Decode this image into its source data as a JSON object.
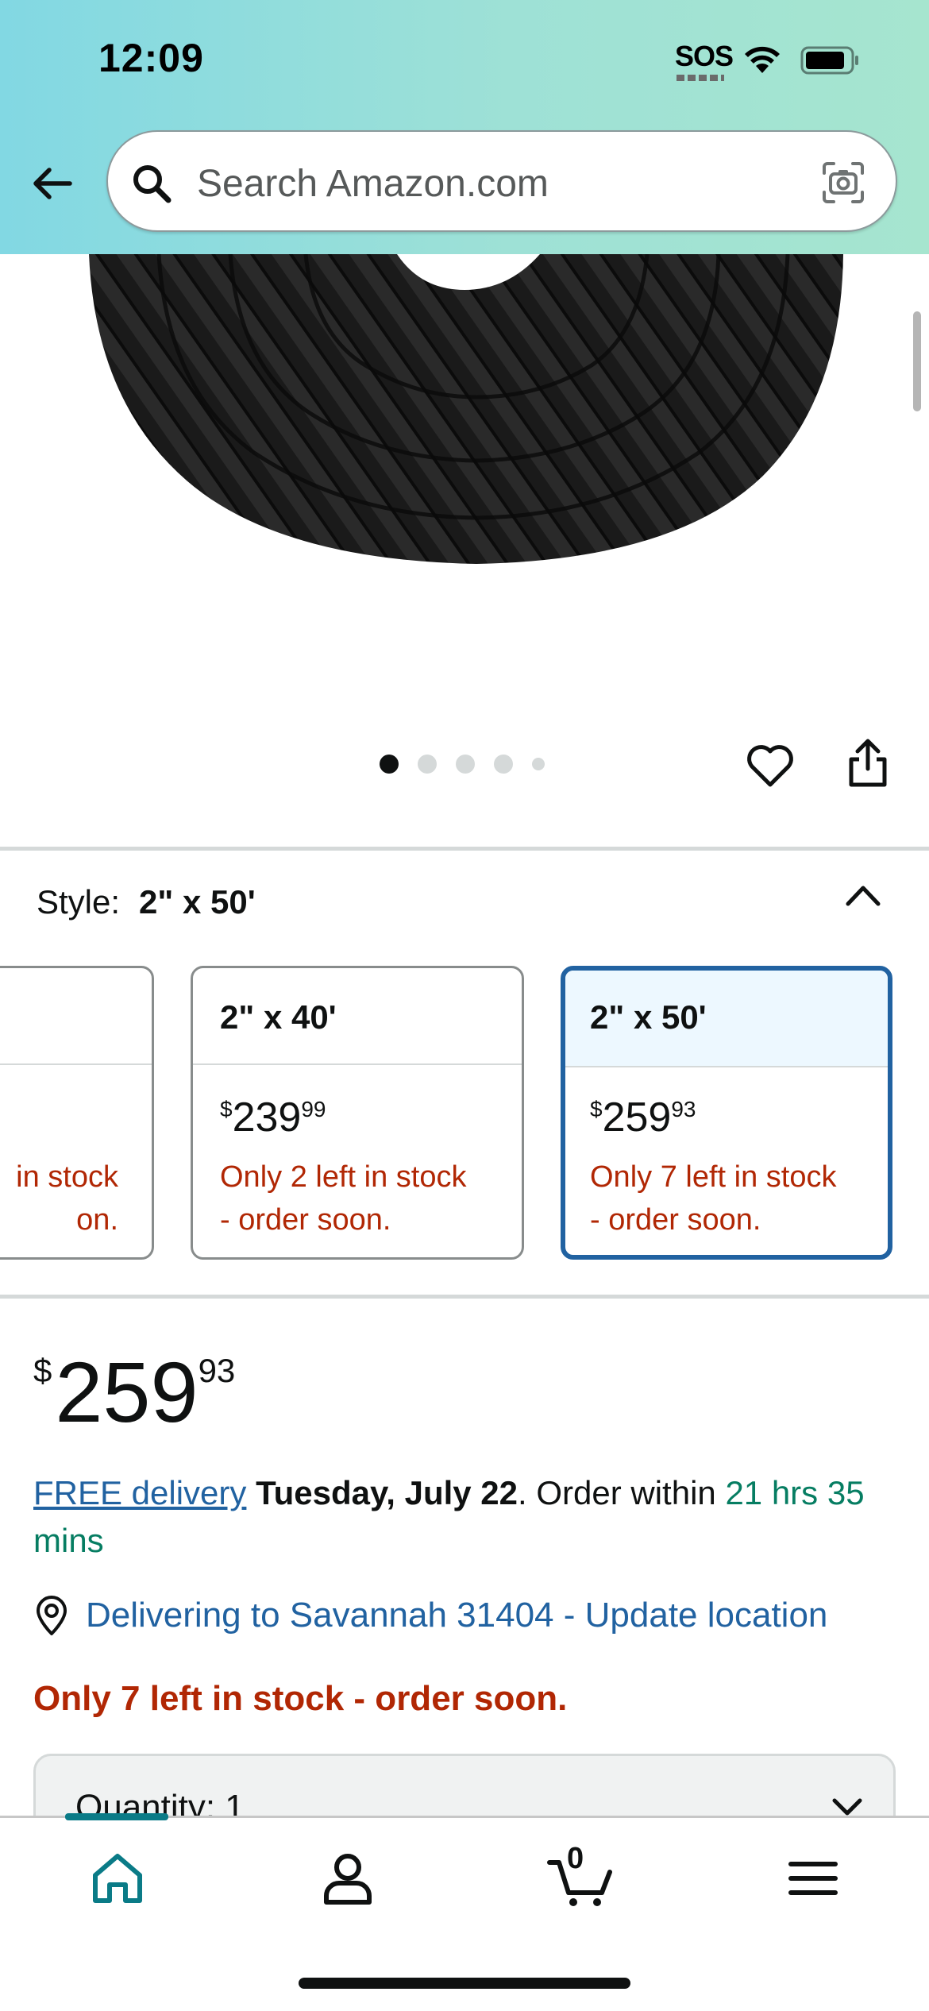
{
  "status_bar": {
    "time": "12:09",
    "sos": "SOS"
  },
  "search": {
    "placeholder": "Search Amazon.com"
  },
  "gallery": {
    "total_images": 5,
    "active_index": 1
  },
  "style": {
    "label": "Style:",
    "selected_value": "2\" x 50'",
    "options": [
      {
        "name": "",
        "price_whole": "",
        "price_fraction": "",
        "stock_line1": "in stock",
        "stock_line2": "on."
      },
      {
        "name": "2\" x 40'",
        "price_whole": "239",
        "price_fraction": "99",
        "stock_line1": "Only 2 left in stock",
        "stock_line2": "- order soon."
      },
      {
        "name": "2\" x 50'",
        "price_whole": "259",
        "price_fraction": "93",
        "stock_line1": "Only 7 left in stock",
        "stock_line2": "- order soon."
      }
    ]
  },
  "price": {
    "currency": "$",
    "whole": "259",
    "fraction": "93"
  },
  "delivery": {
    "link": "FREE delivery",
    "date": "Tuesday, July 22",
    "order_within": ". Order within ",
    "countdown": "21 hrs 35 mins"
  },
  "location": {
    "text": "Delivering to Savannah 31404 - Update location"
  },
  "stock_message": "Only 7 left in stock - order soon.",
  "quantity": {
    "label": "Quantity: 1"
  },
  "bottom_nav": {
    "cart_count": "0"
  },
  "colors": {
    "accent": "#2162a1",
    "alert": "#b12704",
    "success": "#067d62",
    "nav_active": "#0a7b87"
  }
}
